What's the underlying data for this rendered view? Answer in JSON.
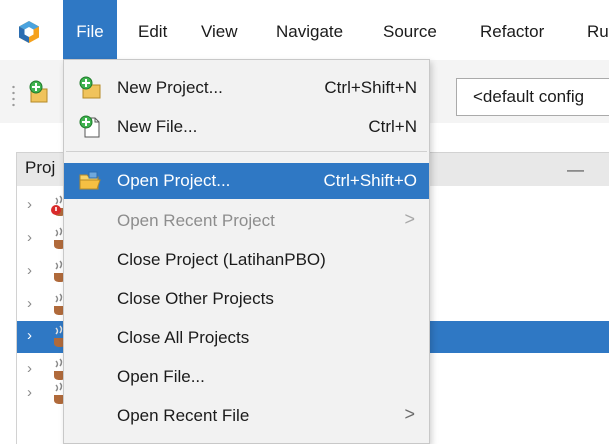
{
  "menubar": {
    "items": [
      "File",
      "Edit",
      "View",
      "Navigate",
      "Source",
      "Refactor",
      "Ru"
    ]
  },
  "toolbar": {
    "config_value": "<default config"
  },
  "projects_panel": {
    "title": "Proj",
    "minimize_glyph": "—",
    "rows": [
      {
        "selected": false
      },
      {
        "selected": false
      },
      {
        "selected": false
      },
      {
        "selected": false
      },
      {
        "selected": true
      },
      {
        "selected": false
      },
      {
        "selected": false
      }
    ]
  },
  "file_menu": {
    "items": [
      {
        "label": "New Project...",
        "shortcut": "Ctrl+Shift+N",
        "icon": "new-project-icon"
      },
      {
        "label": "New File...",
        "shortcut": "Ctrl+N",
        "icon": "new-file-icon"
      },
      {
        "label": "Open Project...",
        "shortcut": "Ctrl+Shift+O",
        "icon": "open-project-icon",
        "highlighted": true
      },
      {
        "label": "Open Recent Project",
        "submenu": true,
        "disabled": true
      },
      {
        "label": "Close Project (LatihanPBO)"
      },
      {
        "label": "Close Other Projects"
      },
      {
        "label": "Close All Projects"
      },
      {
        "label": "Open File..."
      },
      {
        "label": "Open Recent File",
        "submenu": true
      }
    ],
    "submenu_glyph": ">"
  },
  "colors": {
    "accent": "#2f78c4",
    "menu_background": "#f2f2f2",
    "disabled_text": "#8d8d8d"
  }
}
